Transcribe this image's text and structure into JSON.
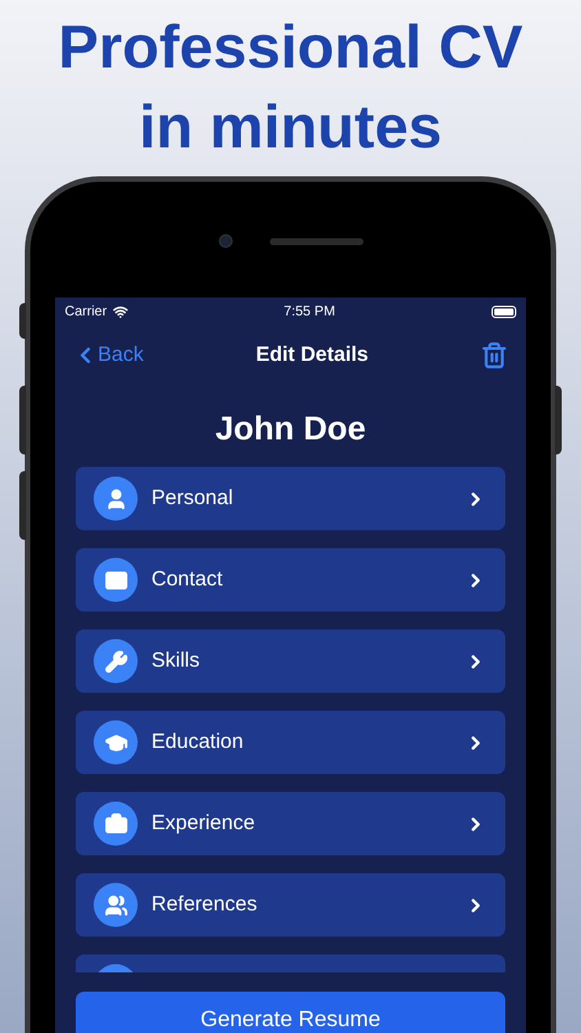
{
  "headline": [
    "Professional CV",
    "in minutes"
  ],
  "status_bar": {
    "carrier": "Carrier",
    "time": "7:55 PM"
  },
  "nav": {
    "back": "Back",
    "title": "Edit Details"
  },
  "name": "John Doe",
  "sections": [
    {
      "label": "Personal"
    },
    {
      "label": "Contact"
    },
    {
      "label": "Skills"
    },
    {
      "label": "Education"
    },
    {
      "label": "Experience"
    },
    {
      "label": "References"
    }
  ],
  "primary_button": "Generate Resume"
}
